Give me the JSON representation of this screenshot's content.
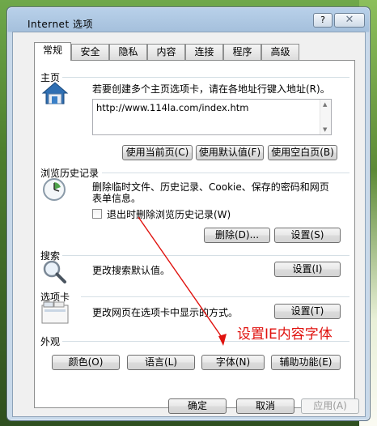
{
  "window": {
    "title": "Internet 选项",
    "help_label": "?",
    "close_label": "✕"
  },
  "tabs": [
    {
      "label": "常规",
      "active": true
    },
    {
      "label": "安全",
      "active": false
    },
    {
      "label": "隐私",
      "active": false
    },
    {
      "label": "内容",
      "active": false
    },
    {
      "label": "连接",
      "active": false
    },
    {
      "label": "程序",
      "active": false
    },
    {
      "label": "高级",
      "active": false
    }
  ],
  "homepage": {
    "section_title": "主页",
    "description": "若要创建多个主页选项卡，请在各地址行键入地址(R)。",
    "address_value": "http://www.114la.com/index.htm",
    "use_current_label": "使用当前页(C)",
    "use_default_label": "使用默认值(F)",
    "use_blank_label": "使用空白页(B)"
  },
  "history": {
    "section_title": "浏览历史记录",
    "description": "删除临时文件、历史记录、Cookie、保存的密码和网页表单信息。",
    "checkbox_label": "退出时删除浏览历史记录(W)",
    "checkbox_checked": false,
    "delete_label": "删除(D)...",
    "settings_label": "设置(S)"
  },
  "search": {
    "section_title": "搜索",
    "description": "更改搜索默认值。",
    "settings_label": "设置(I)"
  },
  "tabs_section": {
    "section_title": "选项卡",
    "description": "更改网页在选项卡中显示的方式。",
    "settings_label": "设置(T)"
  },
  "appearance": {
    "section_title": "外观",
    "colors_label": "颜色(O)",
    "languages_label": "语言(L)",
    "fonts_label": "字体(N)",
    "accessibility_label": "辅助功能(E)"
  },
  "footer": {
    "ok_label": "确定",
    "cancel_label": "取消",
    "apply_label": "应用(A)"
  },
  "annotation": {
    "text": "设置IE内容字体",
    "color": "#e0120e"
  }
}
